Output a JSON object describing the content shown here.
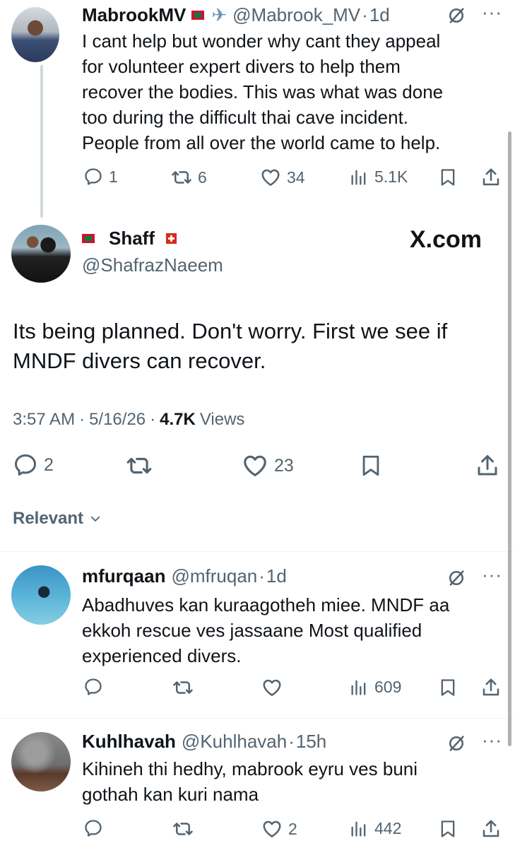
{
  "tweet1": {
    "name": "MabrookMV",
    "handle": "@Mabrook_MV",
    "sep": "·",
    "time": "1d",
    "body": [
      "I cant help but wonder why cant they appeal",
      "for volunteer expert divers to help them",
      "recover the bodies. This was what was done",
      "too during the difficult thai cave incident.",
      "People from all over the world came to help."
    ],
    "replies": "1",
    "reposts": "6",
    "likes": "34",
    "views": "5.1K"
  },
  "main_tweet": {
    "name": "Shaff",
    "handle": "@ShafrazNaeem",
    "brand": "X.com",
    "body": [
      "Its being planned. Don't worry. First we see if",
      "MNDF divers can recover."
    ],
    "time": "3:57 AM",
    "date": "5/16/26",
    "sep": "·",
    "views_count": "4.7K",
    "views_label": "Views",
    "replies": "2",
    "likes": "23"
  },
  "sort": {
    "label": "Relevant"
  },
  "reply1": {
    "name": "mfurqaan",
    "handle": "@mfruqan",
    "sep": "·",
    "time": "1d",
    "body": [
      "Abadhuves kan kuraagotheh miee. MNDF aa",
      "ekkoh rescue ves jassaane Most qualified",
      "experienced divers."
    ],
    "views": "609"
  },
  "reply2": {
    "name": "Kuhlhavah",
    "handle": "@Kuhlhavah",
    "sep": "·",
    "time": "15h",
    "body": [
      "Kihineh thi hedhy, mabrook eyru ves buni",
      "gothah kan kuri nama"
    ],
    "likes": "2",
    "views": "442"
  },
  "icons": [
    "reply-icon",
    "repost-icon",
    "like-icon",
    "views-icon",
    "bookmark-icon",
    "share-icon",
    "grok-icon",
    "more-icon",
    "chevron-down-icon",
    "airplane-icon",
    "maldives-flag-icon",
    "swiss-flag-icon"
  ],
  "colors": {
    "text": "#0f1419",
    "muted": "#536471",
    "divider": "#eff3f4",
    "line": "#cfd9de"
  }
}
